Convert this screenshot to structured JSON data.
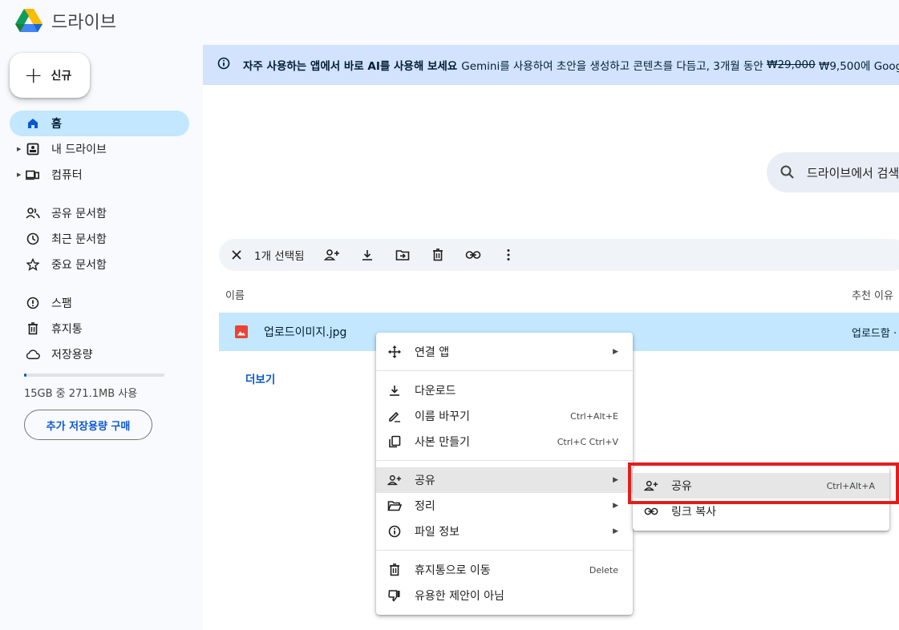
{
  "app": {
    "title": "드라이브"
  },
  "sidebar": {
    "new_label": "신규",
    "items": [
      {
        "label": "홈",
        "icon": "home-icon"
      },
      {
        "label": "내 드라이브",
        "icon": "my-drive-icon"
      },
      {
        "label": "컴퓨터",
        "icon": "computers-icon"
      },
      {
        "label": "공유 문서함",
        "icon": "shared-icon"
      },
      {
        "label": "최근 문서함",
        "icon": "recent-icon"
      },
      {
        "label": "중요 문서함",
        "icon": "star-icon"
      },
      {
        "label": "스팸",
        "icon": "spam-icon"
      },
      {
        "label": "휴지통",
        "icon": "trash-icon"
      },
      {
        "label": "저장용량",
        "icon": "cloud-icon"
      }
    ],
    "storage_text": "15GB 중 271.1MB 사용",
    "storage_fraction": 0.018,
    "buy_label": "추가 저장용량 구매"
  },
  "banner": {
    "title": "자주 사용하는 앱에서 바로 AI를 사용해 보세요",
    "text_before": "Gemini를 사용하여 초안을 생성하고 콘텐츠를 다듬고, 3개월 동안",
    "old_price": "₩29,000",
    "text_after": "₩9,500에 Goog"
  },
  "search": {
    "placeholder": "드라이브에서 검색"
  },
  "selection_bar": {
    "count_label": "1개 선택됨"
  },
  "table": {
    "col_name": "이름",
    "col_reason": "추천 이유",
    "row": {
      "name": "업로드이미지.jpg",
      "reason": "업로드함 ·"
    },
    "more_label": "더보기"
  },
  "context_menu": {
    "open_with": "연결 앱",
    "download": "다운로드",
    "rename": "이름 바꾸기",
    "rename_shortcut": "Ctrl+Alt+E",
    "copy": "사본 만들기",
    "copy_shortcut": "Ctrl+C Ctrl+V",
    "share": "공유",
    "organize": "정리",
    "file_info": "파일 정보",
    "trash": "휴지통으로 이동",
    "trash_shortcut": "Delete",
    "not_helpful": "유용한 제안이 아님"
  },
  "share_submenu": {
    "share": "공유",
    "share_shortcut": "Ctrl+Alt+A",
    "copy_link": "링크 복사"
  },
  "colors": {
    "accent": "#0b57d0",
    "selected": "#c2e7ff",
    "highlight_box": "#e11e1e"
  }
}
